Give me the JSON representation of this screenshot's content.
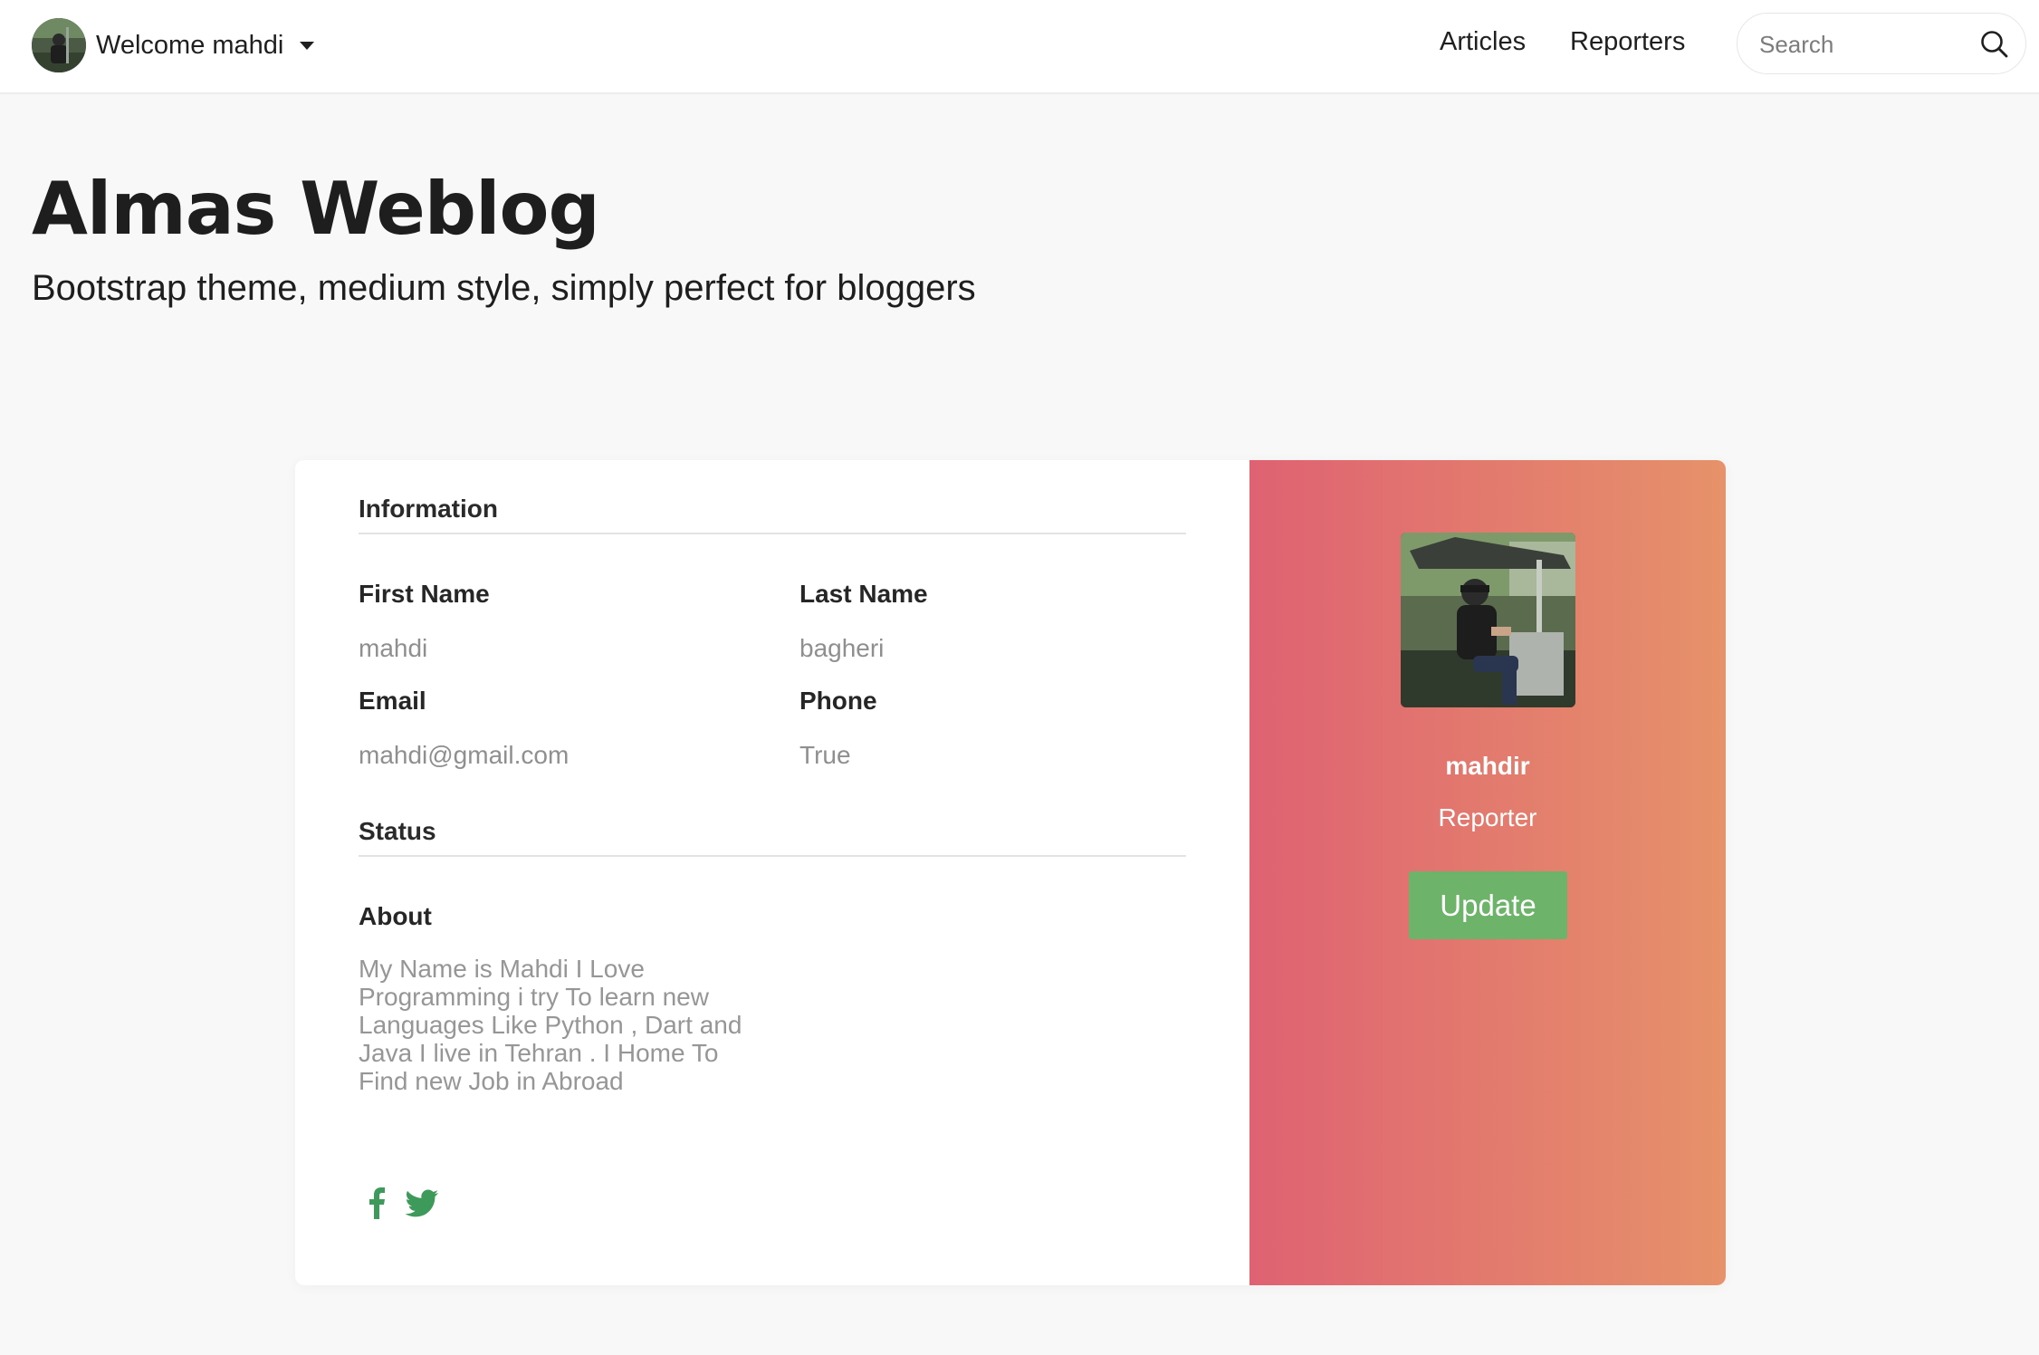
{
  "navbar": {
    "welcome_text": "Welcome mahdi",
    "links": {
      "articles": "Articles",
      "reporters": "Reporters"
    },
    "search": {
      "placeholder": "Search",
      "value": ""
    }
  },
  "hero": {
    "title": "Almas Weblog",
    "subtitle": "Bootstrap theme, medium style, simply perfect for bloggers"
  },
  "profile": {
    "information_heading": "Information",
    "fields": {
      "first_name": {
        "label": "First Name",
        "value": "mahdi"
      },
      "last_name": {
        "label": "Last Name",
        "value": "bagheri"
      },
      "email": {
        "label": "Email",
        "value": "mahdi@gmail.com"
      },
      "phone": {
        "label": "Phone",
        "value": "True"
      }
    },
    "status_heading": "Status",
    "about": {
      "label": "About",
      "text": "My Name is Mahdi I Love Programming i try To learn new Languages Like Python , Dart and Java I live in Tehran . I Home To Find new Job in Abroad"
    },
    "social_icons": [
      "facebook-icon",
      "twitter-icon"
    ],
    "sidebar": {
      "username": "mahdir",
      "role": "Reporter",
      "update_label": "Update"
    }
  },
  "colors": {
    "gradient_start": "#df6272",
    "gradient_end": "#e6926a",
    "update_button": "#6db46a",
    "social_icons": "#3d9a5a"
  }
}
